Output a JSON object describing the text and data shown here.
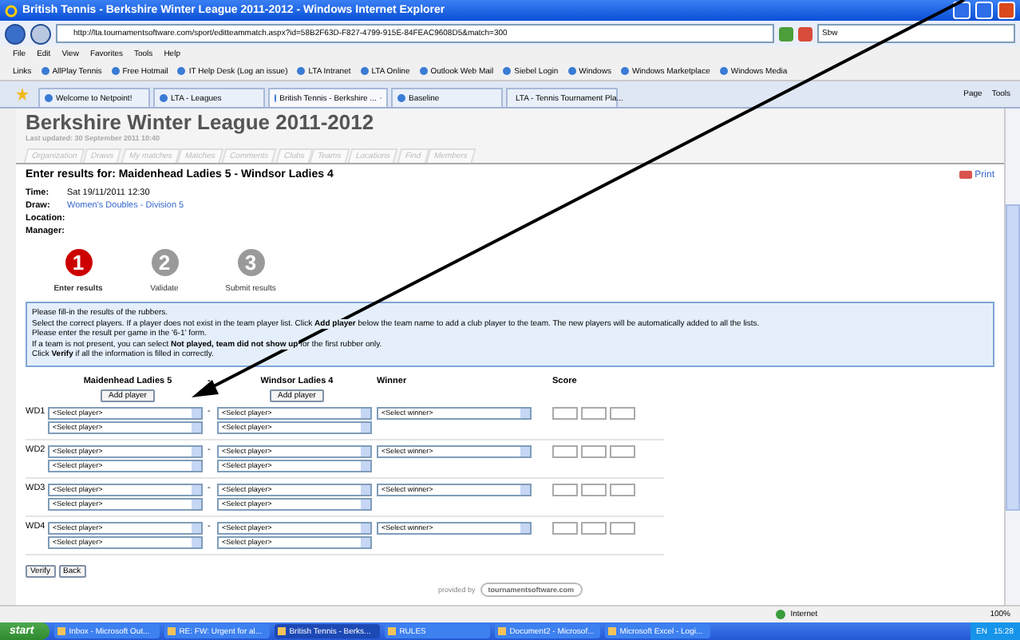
{
  "window": {
    "title": "British Tennis - Berkshire Winter League 2011-2012 - Windows Internet Explorer"
  },
  "address_bar": {
    "url": "http://lta.tournamentsoftware.com/sport/editteammatch.aspx?id=58B2F63D-F827-4799-915E-84FEAC9608D5&match=300",
    "search": "Sbw"
  },
  "menu": [
    "File",
    "Edit",
    "View",
    "Favorites",
    "Tools",
    "Help"
  ],
  "links": {
    "label": "Links",
    "items": [
      "AllPlay Tennis",
      "Free Hotmail",
      "IT Help Desk (Log an issue)",
      "LTA Intranet",
      "LTA Online",
      "Outlook Web Mail",
      "Siebel Login",
      "Windows",
      "Windows Marketplace",
      "Windows Media"
    ]
  },
  "tabs": [
    {
      "label": "Welcome to Netpoint!",
      "selected": false
    },
    {
      "label": "LTA - Leagues",
      "selected": false
    },
    {
      "label": "British Tennis - Berkshire ...",
      "selected": true
    },
    {
      "label": "Baseline",
      "selected": false
    },
    {
      "label": "LTA - Tennis Tournament Pla...",
      "selected": false
    }
  ],
  "command_bar": [
    "Page",
    "Tools"
  ],
  "page": {
    "title": "Berkshire Winter League 2011-2012",
    "last_updated": "Last updated: 30 September 2011 10:40",
    "nav_tabs": [
      "Organization",
      "Draws",
      "My matches",
      "Matches",
      "Comments",
      "Clubs",
      "Teams",
      "Locations",
      "Find",
      "Members"
    ],
    "heading": "Enter results for: Maidenhead Ladies 5 - Windsor Ladies 4",
    "print": "Print",
    "details": [
      {
        "label": "Time:",
        "value": "Sat 19/11/2011 12:30",
        "kind": "text"
      },
      {
        "label": "Draw:",
        "value": "Women's Doubles - Division 5",
        "kind": "link"
      },
      {
        "label": "Location:"
      },
      {
        "label": "Manager:"
      }
    ],
    "steps": [
      {
        "number": "1",
        "label": "Enter results",
        "selected": true
      },
      {
        "number": "2",
        "label": "Validate",
        "selected": false
      },
      {
        "number": "3",
        "label": "Submit results",
        "selected": false
      }
    ],
    "instructions": [
      "Please fill-in the results of the rubbers.",
      "Select the correct players. If a player does not exist in the team player list. Click **Add player** below the team name to add a club player to the team. The new players will be automatically added to all the lists.",
      "Please enter the result per game in the '6-1' form.",
      "If a team is not present, you can select **Not played, team did not show up** for the first rubber only.",
      "Click **Verify** if all the information is filled in correctly."
    ],
    "home_team": "Maidenhead Ladies 5",
    "separator": "-",
    "away_team": "Windsor Ladies 4",
    "winner_heading": "Winner",
    "score_heading": "Score",
    "home_add_player": "Add player",
    "away_add_player": "Add player",
    "rubbers": [
      {
        "label": "WD1",
        "players": [
          "<Select player>",
          "<Select player>",
          "<Select player>",
          "<Select player>"
        ],
        "winner": "<Select winner>"
      },
      {
        "label": "WD2",
        "players": [
          "<Select player>",
          "<Select player>",
          "<Select player>",
          "<Select player>"
        ],
        "winner": "<Select winner>"
      },
      {
        "label": "WD3",
        "players": [
          "<Select player>",
          "<Select player>",
          "<Select player>",
          "<Select player>"
        ],
        "winner": "<Select winner>"
      },
      {
        "label": "WD4",
        "players": [
          "<Select player>",
          "<Select player>",
          "<Select player>",
          "<Select player>"
        ],
        "winner": "<Select winner>"
      }
    ],
    "buttons": [
      "Verify",
      "Back"
    ],
    "provided_by": "provided by",
    "provider": "tournamentsoftware.com"
  },
  "status_bar": {
    "zone": "Internet",
    "zoom": "100%"
  },
  "taskbar": {
    "start": "start",
    "items": [
      {
        "label": "Inbox - Microsoft Out...",
        "selected": false
      },
      {
        "label": "RE: FW: Urgent for al...",
        "selected": false
      },
      {
        "label": "British Tennis - Berks...",
        "selected": true
      },
      {
        "label": "RULES",
        "selected": false
      },
      {
        "label": "Document2 - Microsof...",
        "selected": false
      },
      {
        "label": "Microsoft Excel - Logi...",
        "selected": false
      }
    ],
    "language": "EN",
    "clock": "15:28"
  }
}
